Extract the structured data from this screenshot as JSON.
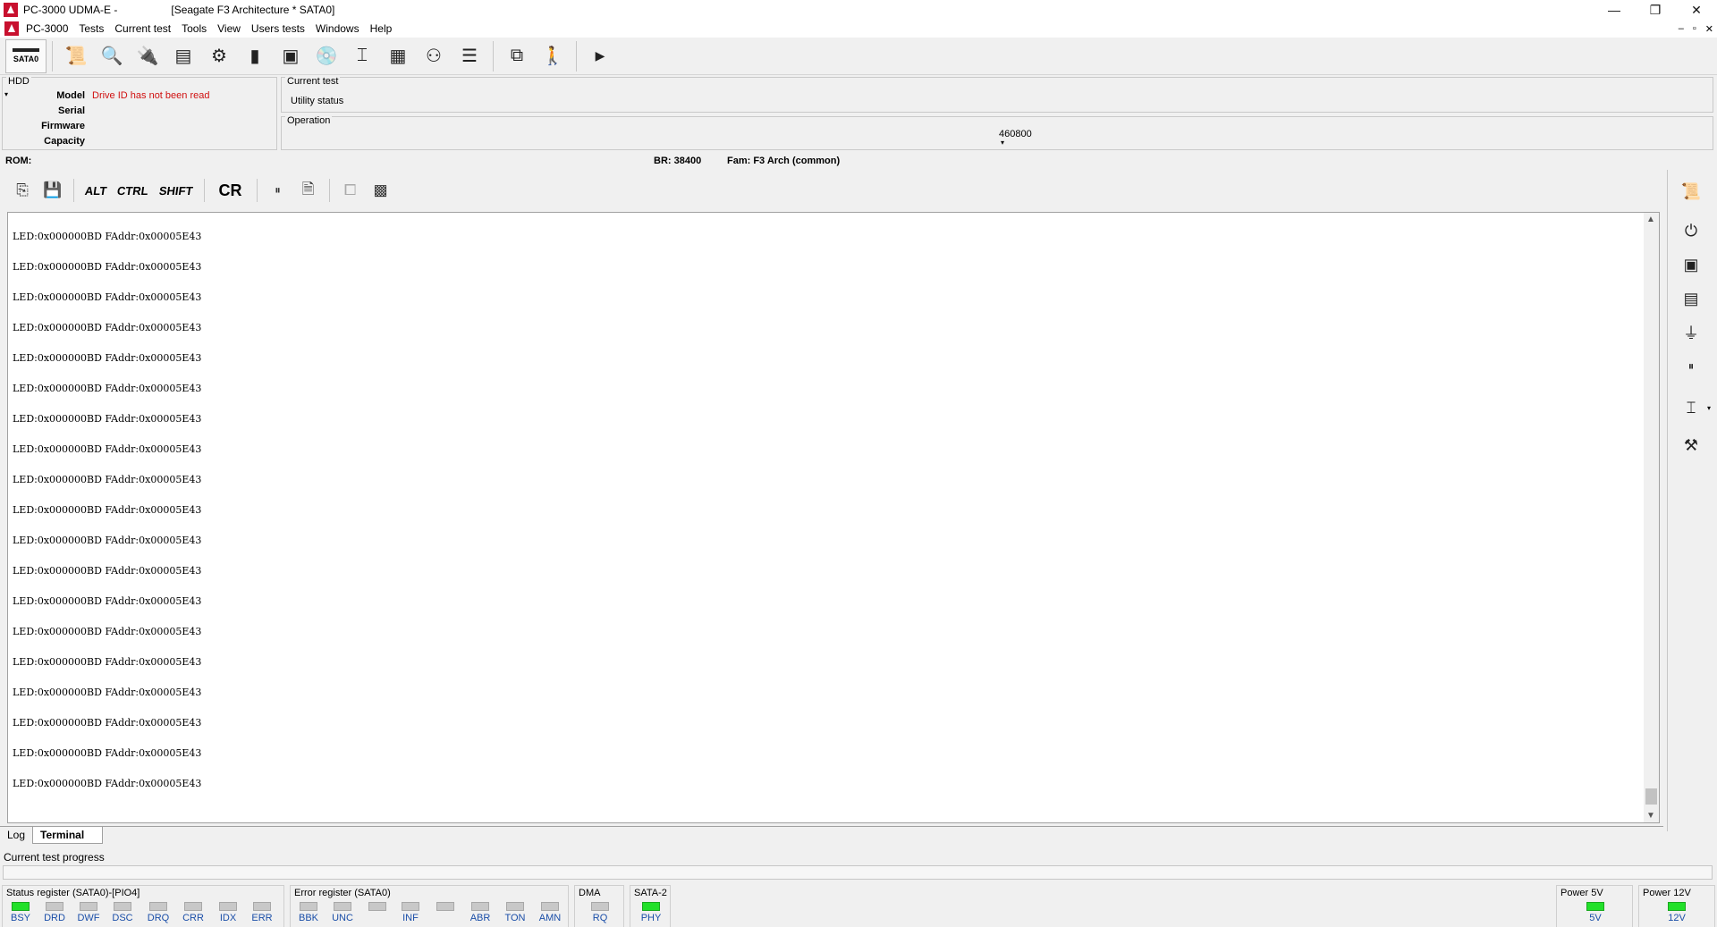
{
  "window": {
    "app_title": "PC-3000 UDMA-E -",
    "doc_title": "[Seagate F3 Architecture * SATA0]",
    "controls": [
      "—",
      "❐",
      "✕"
    ]
  },
  "menu": {
    "items": [
      "PC-3000",
      "Tests",
      "Current test",
      "Tools",
      "View",
      "Users tests",
      "Windows",
      "Help"
    ],
    "mdi_controls": [
      "–",
      "▫",
      "✕"
    ]
  },
  "toolbar": {
    "sata_label": "SATA0"
  },
  "hdd": {
    "caption": "HDD",
    "model_label": "Model",
    "model_value": "Drive ID has not been read",
    "serial_label": "Serial",
    "firmware_label": "Firmware",
    "capacity_label": "Capacity"
  },
  "current_test": {
    "caption": "Current test",
    "status": "Utility status"
  },
  "operation": {
    "caption": "Operation",
    "value": "460800"
  },
  "rom": {
    "label": "ROM:",
    "br": "BR: 38400",
    "fam": "Fam: F3 Arch (common)"
  },
  "terminal_toolbar": {
    "alt": "ALT",
    "ctrl": "CTRL",
    "shift": "SHIFT",
    "cr": "CR"
  },
  "terminal": {
    "lines": [
      "LED:0x000000BD FAddr:0x00005E43",
      "LED:0x000000BD FAddr:0x00005E43",
      "LED:0x000000BD FAddr:0x00005E43",
      "LED:0x000000BD FAddr:0x00005E43",
      "LED:0x000000BD FAddr:0x00005E43",
      "LED:0x000000BD FAddr:0x00005E43",
      "LED:0x000000BD FAddr:0x00005E43",
      "LED:0x000000BD FAddr:0x00005E43",
      "LED:0x000000BD FAddr:0x00005E43",
      "LED:0x000000BD FAddr:0x00005E43",
      "LED:0x000000BD FAddr:0x00005E43",
      "LED:0x000000BD FAddr:0x00005E43",
      "LED:0x000000BD FAddr:0x00005E43",
      "LED:0x000000BD FAddr:0x00005E43",
      "LED:0x000000BD FAddr:0x00005E43",
      "LED:0x000000BD FAddr:0x00005E43",
      "LED:0x000000BD FAddr:0x00005E43",
      "LED:0x000000BD FAddr:0x00005E43",
      "LED:0x000000BD FAddr:0x00005E43"
    ]
  },
  "tabs": {
    "log": "Log",
    "terminal": "Terminal"
  },
  "progress": {
    "label": "Current test progress"
  },
  "status_register": {
    "caption": "Status register (SATA0)-[PIO4]",
    "leds": [
      {
        "label": "BSY",
        "on": true
      },
      {
        "label": "DRD",
        "on": false
      },
      {
        "label": "DWF",
        "on": false
      },
      {
        "label": "DSC",
        "on": false
      },
      {
        "label": "DRQ",
        "on": false
      },
      {
        "label": "CRR",
        "on": false
      },
      {
        "label": "IDX",
        "on": false
      },
      {
        "label": "ERR",
        "on": false
      }
    ]
  },
  "error_register": {
    "caption": "Error register (SATA0)",
    "leds": [
      {
        "label": "BBK",
        "on": false
      },
      {
        "label": "UNC",
        "on": false
      },
      {
        "label": "",
        "on": false
      },
      {
        "label": "INF",
        "on": false
      },
      {
        "label": "",
        "on": false
      },
      {
        "label": "ABR",
        "on": false
      },
      {
        "label": "TON",
        "on": false
      },
      {
        "label": "AMN",
        "on": false
      }
    ]
  },
  "dma": {
    "caption": "DMA",
    "led": {
      "label": "RQ",
      "on": false
    }
  },
  "sata2": {
    "caption": "SATA-2",
    "led": {
      "label": "PHY",
      "on": true
    }
  },
  "power5": {
    "caption": "Power 5V",
    "led": {
      "label": "5V",
      "on": true
    }
  },
  "power12": {
    "caption": "Power 12V",
    "led": {
      "label": "12V",
      "on": true
    }
  }
}
